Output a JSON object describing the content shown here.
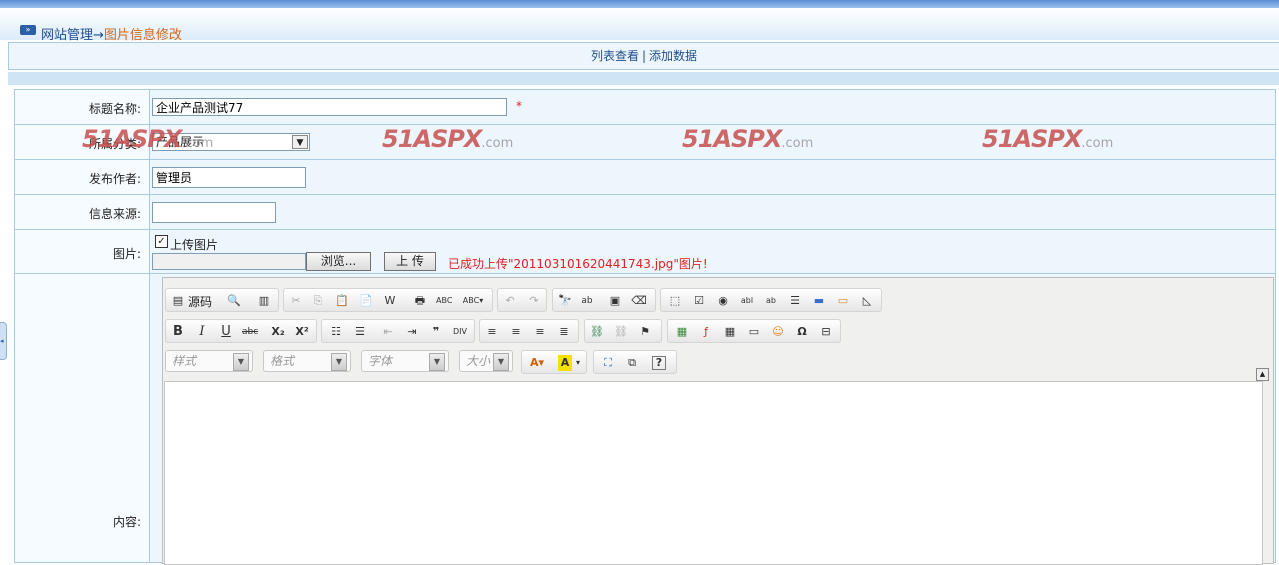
{
  "breadcrumb": {
    "section": "网站管理",
    "arrow": "→",
    "current": "图片信息修改"
  },
  "links": {
    "list": "列表查看",
    "separator": "|",
    "add": "添加数据"
  },
  "watermark": {
    "brand": "51ASPX",
    "suffix": ".com"
  },
  "form": {
    "title": {
      "label": "标题名称:",
      "value": "企业产品测试77",
      "required": "*"
    },
    "category": {
      "label": "所属分类:",
      "value": "产品展示"
    },
    "author": {
      "label": "发布作者:",
      "value": "管理员"
    },
    "source": {
      "label": "信息来源:",
      "value": ""
    },
    "image": {
      "label": "图片:",
      "checkbox_label": "上传图片",
      "checked": true,
      "browse_button": "浏览...",
      "upload_button": "上 传",
      "message": "已成功上传\"201103101620441743.jpg\"图片!"
    },
    "content": {
      "label": "内容:"
    }
  },
  "editor": {
    "source_button": "源码",
    "combos": {
      "style": "样式",
      "format": "格式",
      "font": "字体",
      "size": "大小"
    }
  }
}
